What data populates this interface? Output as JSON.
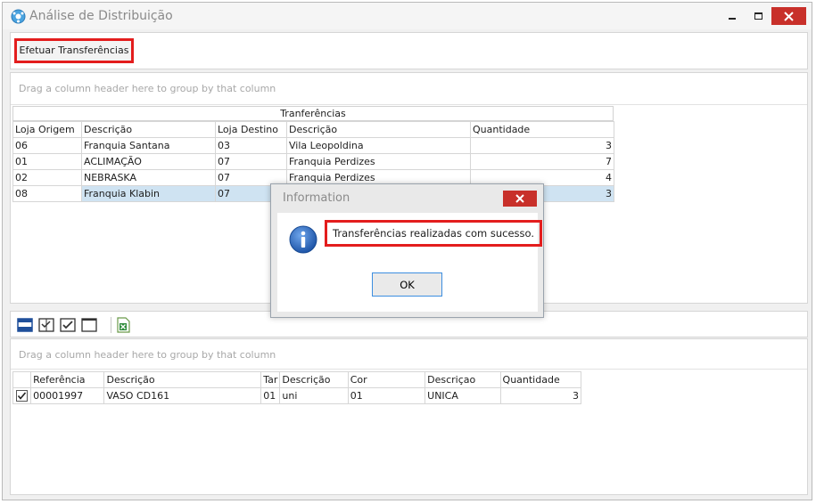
{
  "window": {
    "title": "Análise de Distribuição"
  },
  "toolbar": {
    "efetuar_label": "Efetuar Transferências"
  },
  "transfers_grid": {
    "group_hint": "Drag a column header here to group by that column",
    "band_title": "Tranferências",
    "columns": [
      "Loja Origem",
      "Descrição",
      "Loja Destino",
      "Descrição",
      "Quantidade"
    ],
    "rows": [
      {
        "origem": "06",
        "desc_origem": "Franquia Santana",
        "destino": "03",
        "desc_destino": "Vila Leopoldina",
        "qtd": "3"
      },
      {
        "origem": "01",
        "desc_origem": "ACLIMAÇÃO",
        "destino": "07",
        "desc_destino": "Franquia Perdizes",
        "qtd": "7"
      },
      {
        "origem": "02",
        "desc_origem": "NEBRASKA",
        "destino": "07",
        "desc_destino": "Franquia Perdizes",
        "qtd": "4"
      },
      {
        "origem": "08",
        "desc_origem": "Franquia Klabin",
        "destino": "07",
        "desc_destino": "",
        "qtd": "3"
      }
    ]
  },
  "detail_grid": {
    "group_hint": "Drag a column header here to group by that column",
    "columns": [
      "",
      "Referência",
      "Descrição",
      "Tar",
      "Descrição",
      "Cor",
      "Descriçao",
      "Quantidade"
    ],
    "rows": [
      {
        "checked": true,
        "referencia": "00001997",
        "descricao": "VASO CD161",
        "tar": "01",
        "desc_tar": "uni",
        "cor": "01",
        "desc_cor": "UNICA",
        "qtd": "3"
      }
    ]
  },
  "dialog": {
    "title": "Information",
    "message": "Transferências realizadas com sucesso.",
    "ok_label": "OK"
  },
  "colors": {
    "close_red": "#c8302a",
    "highlight_red": "#e31d1d",
    "selected_row": "#cfe3f2",
    "info_blue": "#2a64b8"
  }
}
